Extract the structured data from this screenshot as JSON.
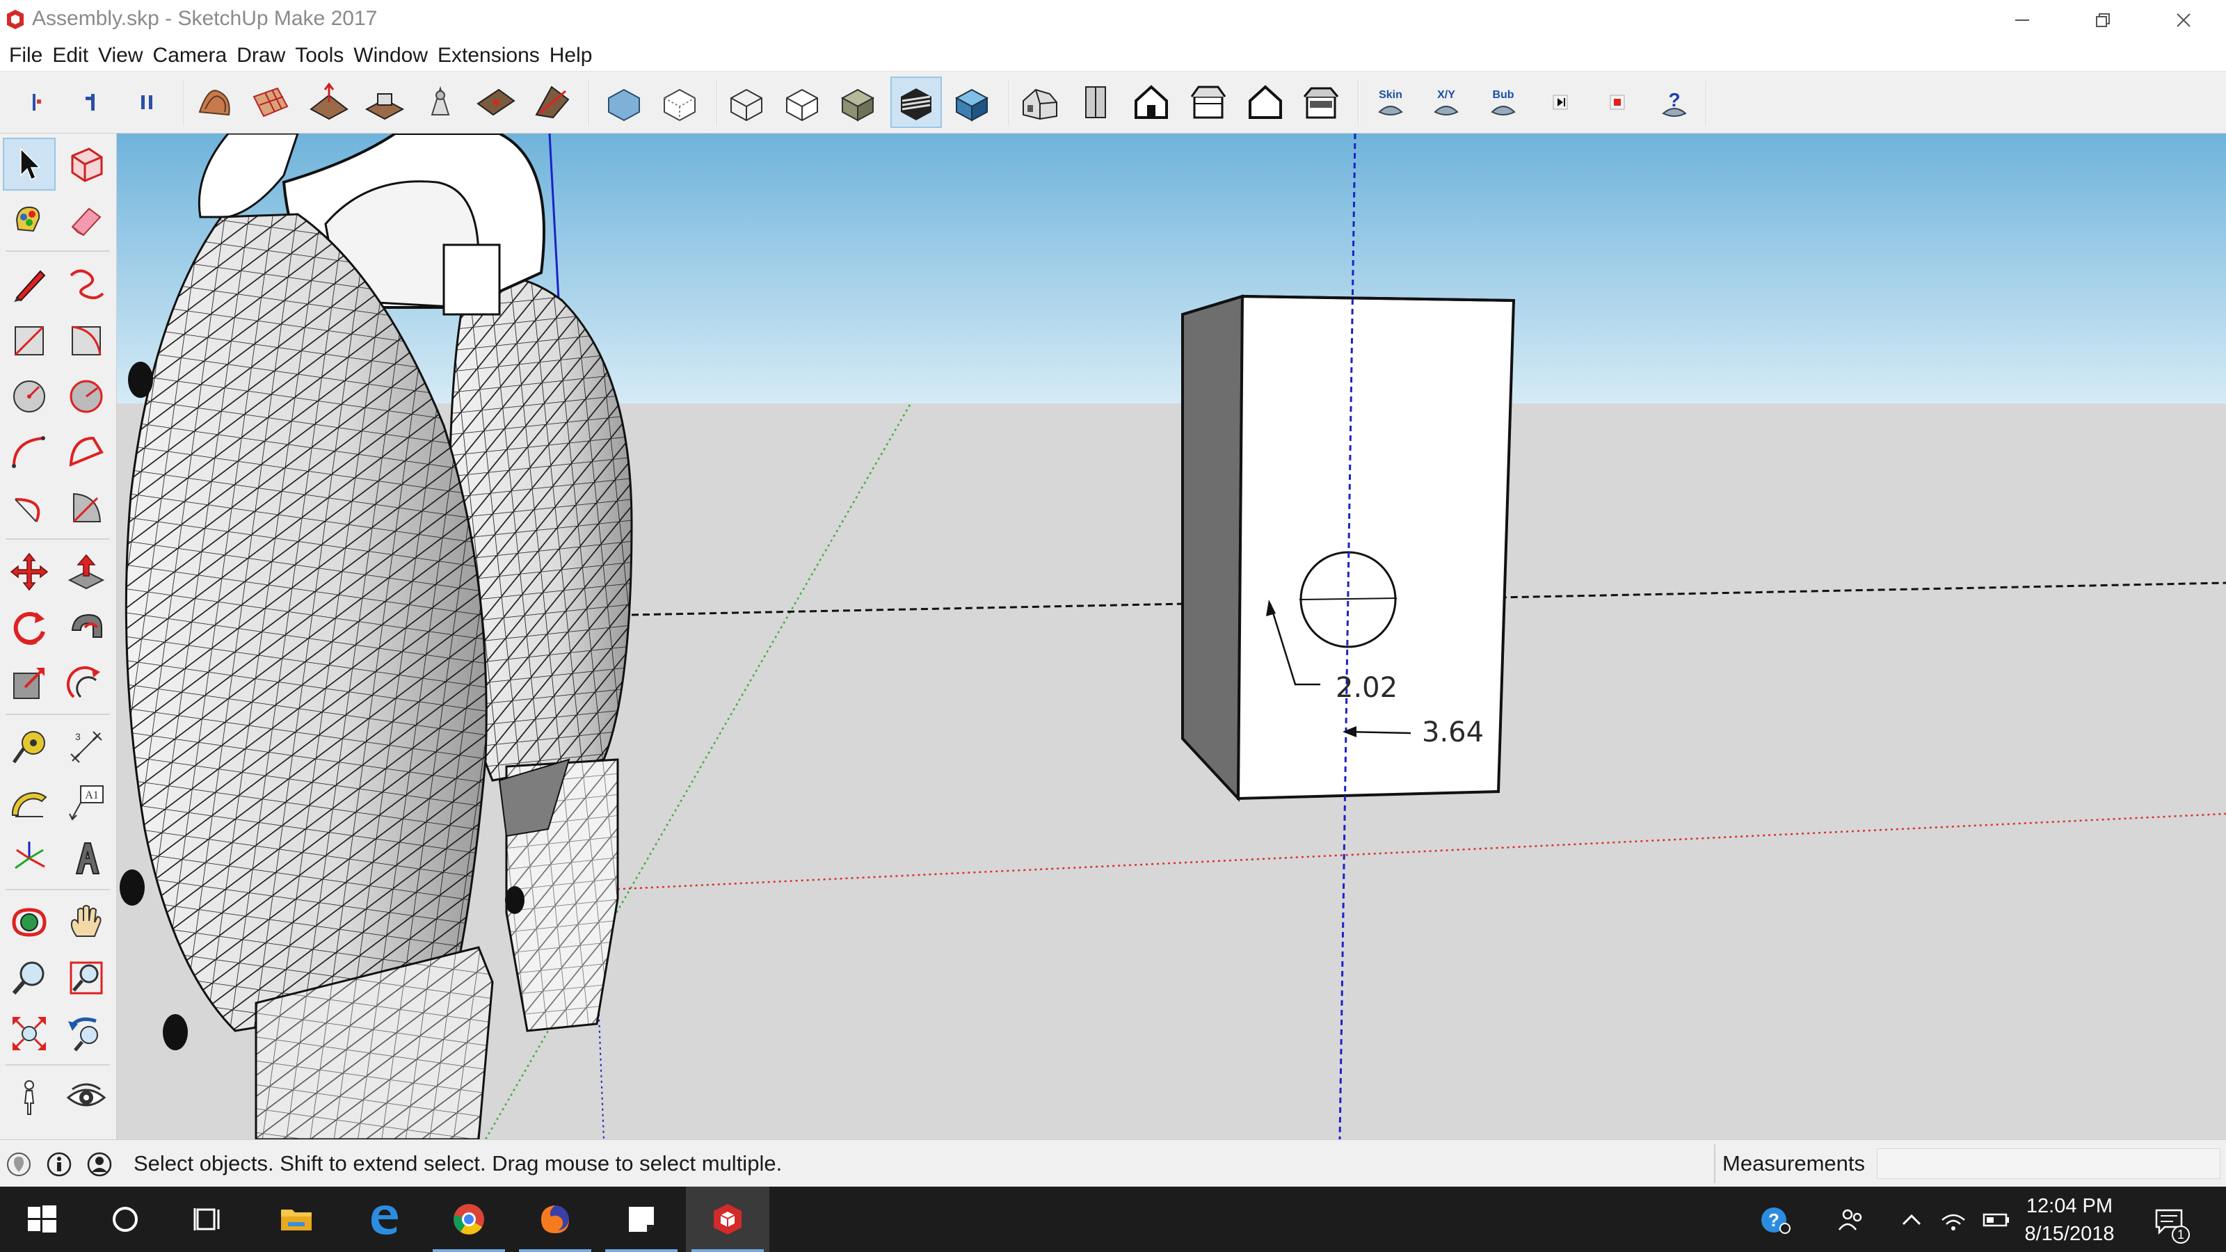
{
  "window": {
    "title": "Assembly.skp - SketchUp Make 2017"
  },
  "menu": [
    "File",
    "Edit",
    "View",
    "Camera",
    "Draw",
    "Tools",
    "Window",
    "Extensions",
    "Help"
  ],
  "toolbar": {
    "extension_labels": {
      "skin": "Skin",
      "xy": "X/Y",
      "bub": "Bub"
    }
  },
  "viewport": {
    "dimensions": {
      "horizontal": "2.02",
      "vertical": "3.64"
    },
    "colors": {
      "sky": "#8fc5e6",
      "ground": "#d7d7d7",
      "red_axis": "#d9312b",
      "green_axis": "#3fae3f",
      "blue_axis": "#1a23c8"
    }
  },
  "statusbar": {
    "message": "Select objects. Shift to extend select. Drag mouse to select multiple.",
    "measurements_label": "Measurements",
    "measurements_value": ""
  },
  "taskbar": {
    "time": "12:04 PM",
    "date": "8/15/2018",
    "notification_count": "1"
  }
}
